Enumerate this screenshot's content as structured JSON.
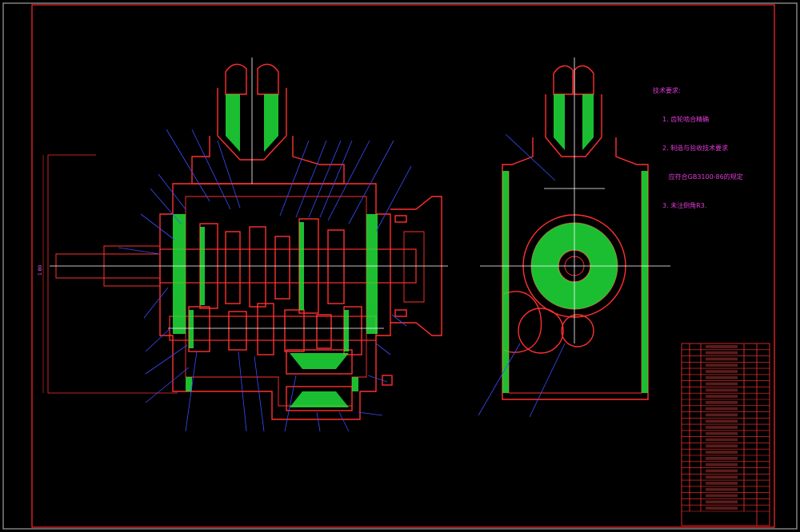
{
  "colors": {
    "background": "#000000",
    "frame": "#ff2a2a",
    "outline": "#ff3030",
    "hatch": "#22e03a",
    "leader": "#3a4dff",
    "centerline": "#ffffff",
    "dimension": "#ff66ff",
    "notes": "#e03cd8",
    "table_text": "#ff5050"
  },
  "tech_notes": {
    "title": "技术要求:",
    "lines": [
      "1. 齿轮啮合精确",
      "2. 制造与验收技术要求",
      "   应符合GB3100-86的规定",
      "3. 未注倒角R3."
    ]
  },
  "dimensions": {
    "overall_height": "1 80"
  }
}
